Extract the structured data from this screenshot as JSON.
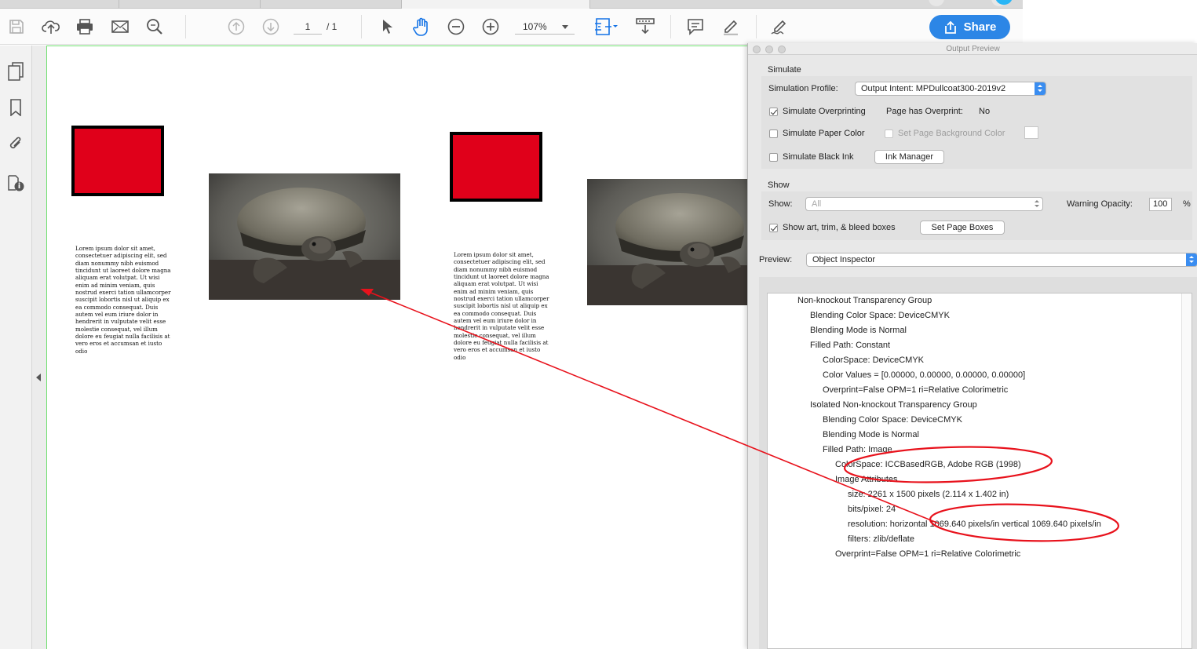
{
  "toolbar": {
    "page_current": "1",
    "page_total": "/ 1",
    "zoom": "107%",
    "share_label": "Share"
  },
  "document": {
    "lorem_left": "Lorem ipsum dolor sit amet, consectetuer adipiscing elit, sed diam nonummy nibh euismod tincidunt ut laoreet dolore magna aliquam erat volutpat. Ut wisi enim ad minim veniam, quis nostrud exerci tation ullamcorper suscipit lobortis nisl ut aliquip ex ea commodo consequat. Duis autem vel eum iriure dolor in hendrerit in vulputate velit esse molestie consequat, vel illum dolore eu feugiat nulla facilisis at vero eros et accumsan et iusto odio",
    "lorem_right": "Lorem ipsum dolor sit amet, consectetuer adipiscing elit, sed diam nonummy nibh euismod tincidunt ut laoreet dolore magna aliquam erat volutpat. Ut wisi enim ad minim veniam, quis nostrud exerci tation ullamcorper suscipit lobortis nisl ut aliquip ex ea commodo consequat. Duis autem vel eum iriure dolor in hendrerit in vulputate velit esse molestie consequat, vel illum dolore eu feugiat nulla facilisis at vero eros et accumsan et iusto odio",
    "box_color": "#e0001a"
  },
  "panel": {
    "title": "Output Preview",
    "simulate_heading": "Simulate",
    "simulation_profile_label": "Simulation Profile:",
    "simulation_profile_value": "Output Intent: MPDullcoat300-2019v2",
    "simulate_overprinting": "Simulate Overprinting",
    "page_has_overprint_label": "Page has Overprint:",
    "page_has_overprint_value": "No",
    "simulate_paper_color": "Simulate Paper Color",
    "set_page_background_color": "Set Page Background Color",
    "simulate_black_ink": "Simulate Black Ink",
    "ink_manager": "Ink Manager",
    "show_heading": "Show",
    "show_label": "Show:",
    "show_value": "All",
    "warning_opacity_label": "Warning Opacity:",
    "warning_opacity_value": "100",
    "percent": "%",
    "show_boxes": "Show art, trim, & bleed boxes",
    "set_page_boxes": "Set Page Boxes",
    "preview_label": "Preview:",
    "preview_value": "Object Inspector",
    "tree": [
      "Non-knockout Transparency Group",
      "Blending Color Space: DeviceCMYK",
      "Blending Mode is Normal",
      "Filled Path: Constant",
      "ColorSpace: DeviceCMYK",
      "Color Values = [0.00000, 0.00000, 0.00000, 0.00000]",
      "Overprint=False OPM=1 ri=Relative Colorimetric",
      "Isolated Non-knockout Transparency Group",
      "Blending Color Space: DeviceCMYK",
      "Blending Mode is Normal",
      "Filled Path: Image",
      "ColorSpace: ICCBasedRGB, Adobe RGB (1998)",
      "Image Attributes",
      "size: 2261 x 1500 pixels (2.114 x 1.402 in)",
      "bits/pixel: 24",
      "resolution: horizontal 1069.640 pixels/in vertical 1069.640 pixels/in",
      "filters: zlib/deflate",
      "Overprint=False OPM=1 ri=Relative Colorimetric"
    ]
  },
  "colors": {
    "annotation": "#e8121c",
    "share_blue": "#2c86e6",
    "tool_blue": "#1473e6"
  }
}
